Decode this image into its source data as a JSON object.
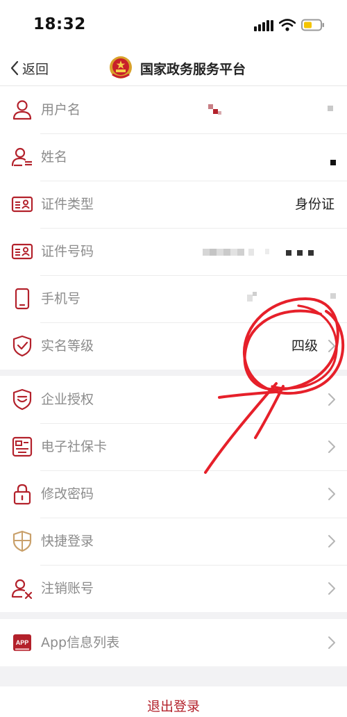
{
  "status_bar": {
    "time": "18:32",
    "icons": [
      "signal-icon",
      "wifi-icon",
      "battery-icon"
    ]
  },
  "nav": {
    "back_label": "返回",
    "title": "国家政务服务平台",
    "logo_icon": "national-emblem-icon"
  },
  "profile": {
    "username_label": "用户名",
    "name_label": "姓名",
    "id_type_label": "证件类型",
    "id_type_value": "身份证",
    "id_number_label": "证件号码",
    "phone_label": "手机号",
    "realname_level_label": "实名等级",
    "realname_level_value": "四级"
  },
  "settings": {
    "enterprise_auth": "企业授权",
    "social_card": "电子社保卡",
    "change_password": "修改密码",
    "quick_login": "快捷登录",
    "cancel_account": "注销账号"
  },
  "app_info": {
    "label": "App信息列表",
    "badge": "APP"
  },
  "logout_label": "退出登录",
  "colors": {
    "accent": "#b3212b",
    "annotation": "#e6202a",
    "label_gray": "#8c8c8c"
  }
}
